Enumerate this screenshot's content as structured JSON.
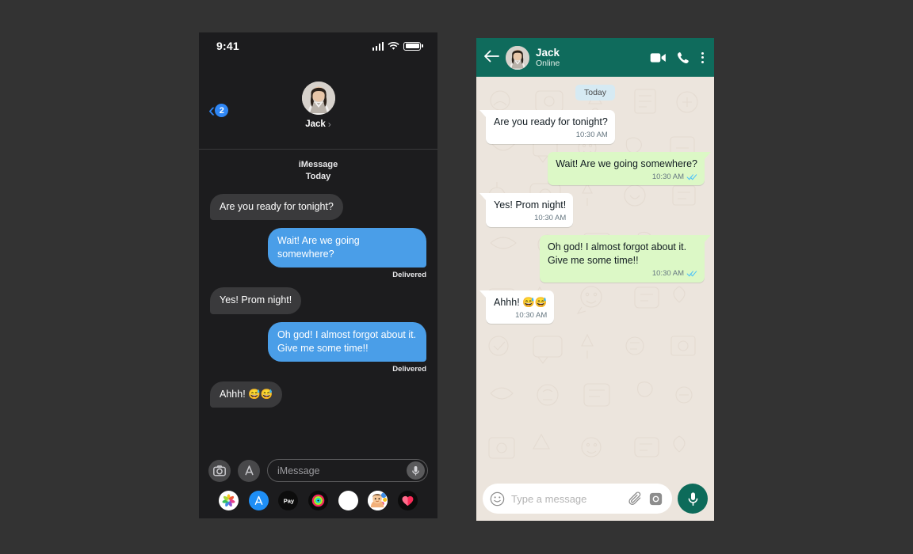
{
  "canvas": {
    "background": "#333333"
  },
  "imessage": {
    "status_bar": {
      "time": "9:41",
      "signal_icon": "cellular-signal-icon",
      "wifi_icon": "wifi-icon",
      "battery_icon": "battery-icon"
    },
    "nav": {
      "back_icon": "back-chevron-icon",
      "unread_badge": "2",
      "contact_name": "Jack",
      "contact_chevron": "›",
      "avatar_icon": "contact-avatar"
    },
    "thread": {
      "service_label": "iMessage",
      "day_label": "Today",
      "messages": [
        {
          "text": "Are you ready for tonight?",
          "direction": "in",
          "receipt": ""
        },
        {
          "text": "Wait! Are we going somewhere?",
          "direction": "out",
          "receipt": "Delivered"
        },
        {
          "text": "Yes! Prom night!",
          "direction": "in",
          "receipt": ""
        },
        {
          "text": "Oh god! I almost forgot about it. Give me some time!!",
          "direction": "out",
          "receipt": "Delivered"
        },
        {
          "text": "Ahhh! 😅😅",
          "direction": "in",
          "receipt": ""
        }
      ]
    },
    "composer": {
      "camera_icon": "camera-icon",
      "appstore_icon": "app-store-icon",
      "placeholder": "iMessage",
      "mic_icon": "microphone-icon"
    },
    "app_drawer": [
      {
        "name": "photos-app-icon",
        "label": "Photos"
      },
      {
        "name": "app-store-app-icon",
        "label": "App Store"
      },
      {
        "name": "apple-pay-app-icon",
        "label": "Apple Pay"
      },
      {
        "name": "fitness-app-icon",
        "label": "Fitness"
      },
      {
        "name": "blank-app-icon",
        "label": ""
      },
      {
        "name": "memoji-app-icon",
        "label": "Memoji"
      },
      {
        "name": "health-app-icon",
        "label": "Health"
      }
    ],
    "colors": {
      "background": "#1c1c1e",
      "incoming_bubble": "#3a3a3c",
      "outgoing_bubble": "#4a9ee8",
      "accent": "#2f87f6"
    }
  },
  "whatsapp": {
    "header": {
      "back_icon": "back-arrow-icon",
      "avatar_icon": "contact-avatar",
      "contact_name": "Jack",
      "presence": "Online",
      "video_icon": "video-call-icon",
      "call_icon": "phone-call-icon",
      "menu_icon": "overflow-menu-icon"
    },
    "thread": {
      "day_pill": "Today",
      "messages": [
        {
          "text": "Are you ready for tonight?",
          "direction": "in",
          "time": "10:30 AM",
          "ticks": false
        },
        {
          "text": "Wait! Are we going somewhere?",
          "direction": "out",
          "time": "10:30 AM",
          "ticks": true
        },
        {
          "text": "Yes! Prom night!",
          "direction": "in",
          "time": "10:30 AM",
          "ticks": false
        },
        {
          "text": "Oh god! I almost forgot about it. Give me some time!!",
          "direction": "out",
          "time": "10:30 AM",
          "ticks": true
        },
        {
          "text": "Ahhh! 😅😅",
          "direction": "in",
          "time": "10:30 AM",
          "ticks": false
        }
      ]
    },
    "composer": {
      "emoji_icon": "emoji-smiley-icon",
      "placeholder": "Type a message",
      "attach_icon": "paperclip-icon",
      "camera_icon": "camera-icon",
      "mic_icon": "microphone-icon"
    },
    "colors": {
      "header": "#0f6b5c",
      "chat_background": "#ece5dd",
      "incoming_bubble": "#ffffff",
      "outgoing_bubble": "#dcf8c6",
      "tick_blue": "#4fc3f7",
      "mic_button": "#0d6b5a",
      "day_pill": "#d6eaf3"
    }
  }
}
